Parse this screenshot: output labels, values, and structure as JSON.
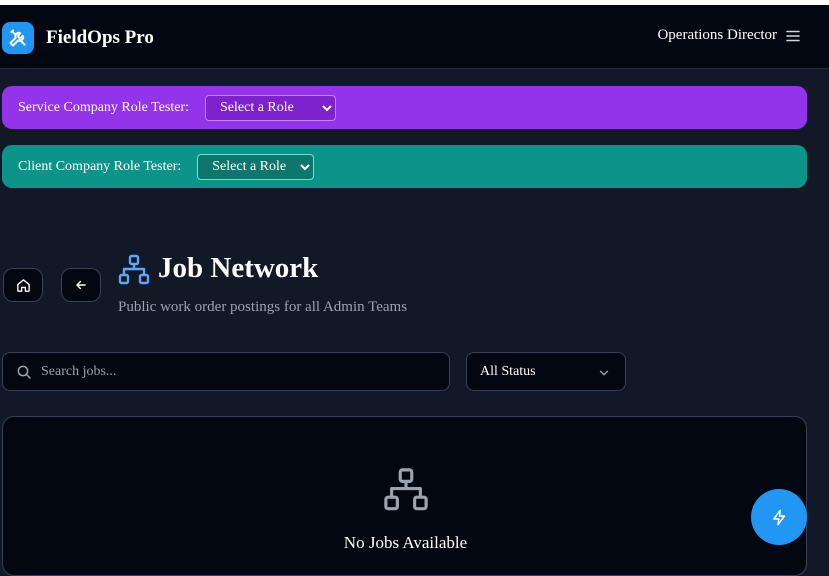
{
  "app": {
    "title": "FieldOps Pro",
    "current_role": "Operations Director",
    "brand_color": "#2196f3"
  },
  "role_testers": {
    "service": {
      "label": "Service Company Role Tester:",
      "selected": "Select a Role",
      "color": "#9333ea"
    },
    "client": {
      "label": "Client Company Role Tester:",
      "selected": "Select a Role",
      "color": "#0d9488"
    }
  },
  "page": {
    "title": "Job Network",
    "subtitle": "Public work order postings for all Admin Teams",
    "icon": "network-icon"
  },
  "filters": {
    "search_placeholder": "Search jobs...",
    "search_value": "",
    "status_selected": "All Status"
  },
  "empty_state": {
    "title": "No Jobs Available",
    "icon": "network-icon"
  },
  "icons": {
    "logo": "wrench-screwdriver-icon",
    "menu": "hamburger-menu-icon",
    "home": "home-icon",
    "back": "arrow-left-icon",
    "search": "search-icon",
    "dropdown": "chevron-down-icon",
    "fab": "lightning-bolt-icon"
  }
}
